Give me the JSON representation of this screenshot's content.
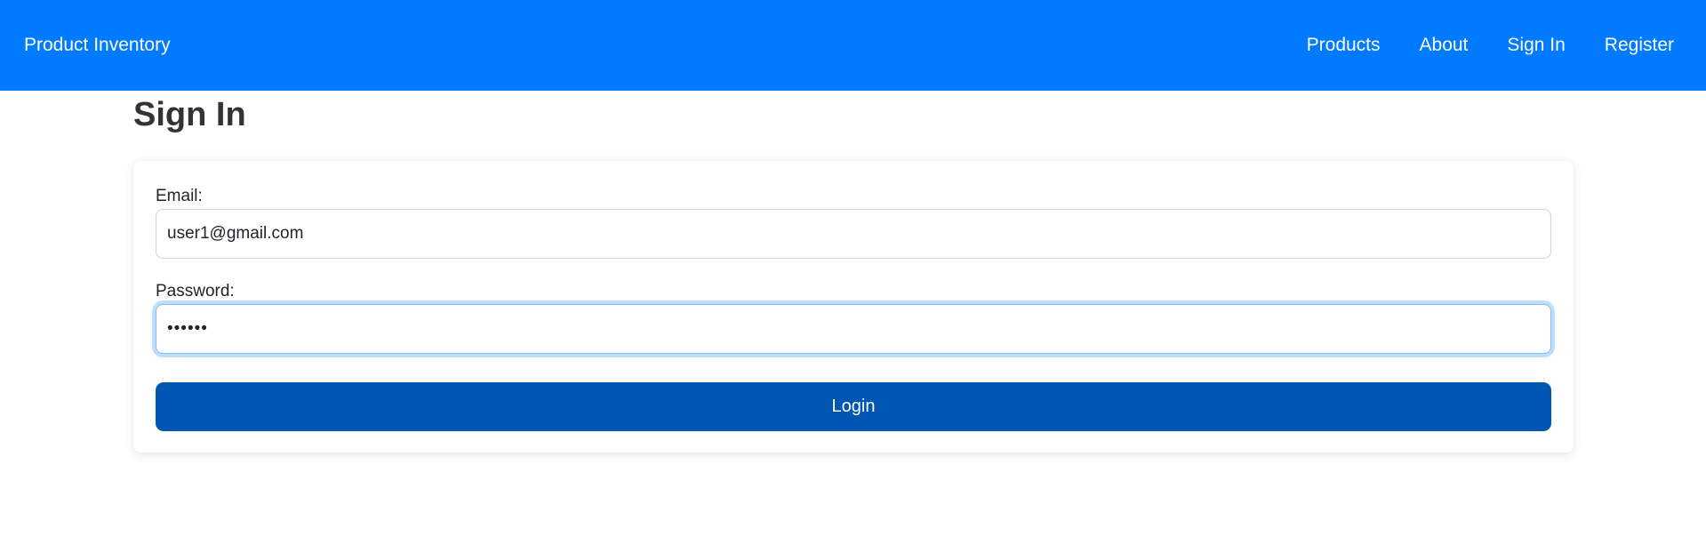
{
  "navbar": {
    "brand": "Product Inventory",
    "links": [
      {
        "label": "Products"
      },
      {
        "label": "About"
      },
      {
        "label": "Sign In"
      },
      {
        "label": "Register"
      }
    ],
    "background_color": "#007bff"
  },
  "page": {
    "title": "Sign In"
  },
  "form": {
    "email": {
      "label": "Email:",
      "value": "user1@gmail.com"
    },
    "password": {
      "label": "Password:",
      "value": "••••••",
      "focused": true
    },
    "submit_label": "Login",
    "submit_color": "#0056b3"
  }
}
